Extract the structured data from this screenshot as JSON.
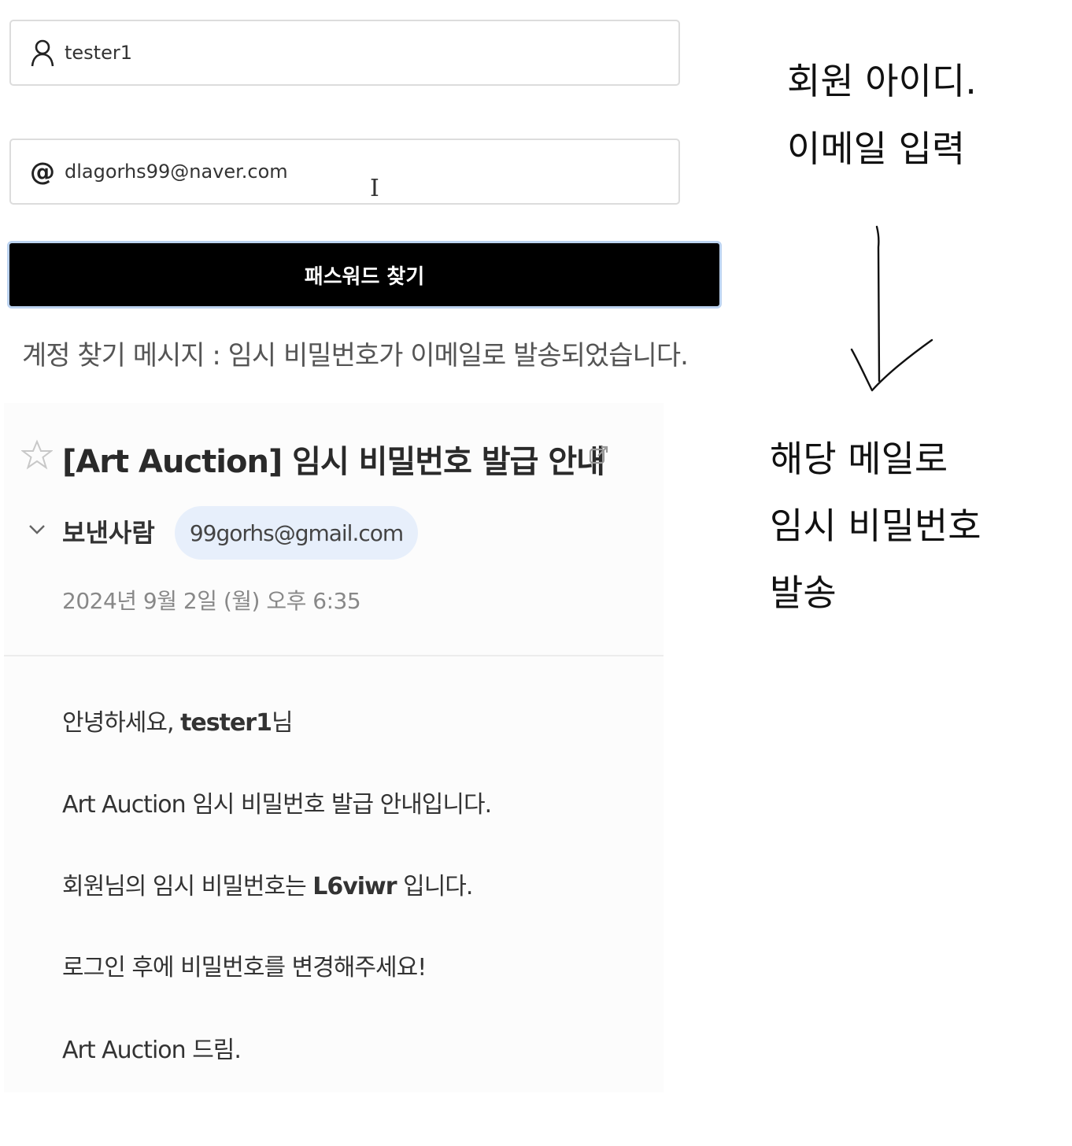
{
  "form": {
    "username_value": "tester1",
    "email_value": "dlagorhs99@naver.com",
    "find_button_label": "패스워드 찾기",
    "result_message": "계정 찾기 메시지 : 임시 비밀번호가 이메일로 발송되었습니다."
  },
  "email": {
    "subject": "[Art Auction] 임시 비밀번호 발급 안내",
    "sender_label": "보낸사람",
    "sender_address": "99gorhs@gmail.com",
    "date": "2024년 9월 2일 (월) 오후 6:35",
    "greeting_prefix": "안녕하세요, ",
    "greeting_name": "tester1",
    "greeting_suffix": "님",
    "line_intro": "Art Auction 임시 비밀번호 발급 안내입니다.",
    "line_password_prefix": "회원님의 임시 비밀번호는 ",
    "temp_password": "L6viwr",
    "line_password_suffix": " 입니다.",
    "line_change": "로그인 후에 비밀번호를 변경해주세요!",
    "signoff": "Art Auction 드림."
  },
  "annotations": {
    "note1_line1": "회원 아이디.",
    "note1_line2": "이메일 입력",
    "note2_line1": "해당 메일로",
    "note2_line2": "임시 비밀번호",
    "note2_line3": "발송"
  },
  "icons": [
    "user-icon",
    "at-icon",
    "text-cursor-icon",
    "star-icon",
    "external-link-icon",
    "chevron-down-icon",
    "hand-drawn-arrow-icon"
  ],
  "colors": {
    "button_bg": "#000000",
    "button_focus_ring": "#bcd3f0",
    "sender_chip_bg": "#e7effb"
  }
}
